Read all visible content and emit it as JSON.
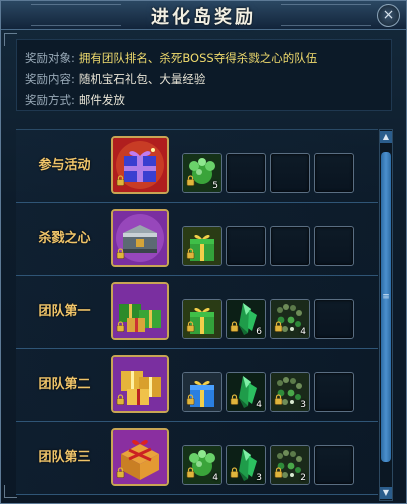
{
  "window": {
    "title": "进化岛奖励",
    "close_label": "×"
  },
  "info": [
    {
      "key": "奖励对象:",
      "value": "拥有团队排名、杀死BOSS夺得杀戮之心的队伍",
      "highlight": true
    },
    {
      "key": "奖励内容:",
      "value": "随机宝石礼包、大量经验",
      "highlight": false
    },
    {
      "key": "奖励方式:",
      "value": "邮件发放",
      "highlight": false
    }
  ],
  "rows": [
    {
      "label": "参与活动",
      "chest": "blue-gift-chest",
      "slots": [
        {
          "icon": "green-exp-orb-icon",
          "count": "5"
        },
        {
          "icon": "",
          "count": ""
        },
        {
          "icon": "",
          "count": ""
        },
        {
          "icon": "",
          "count": ""
        }
      ]
    },
    {
      "label": "杀戮之心",
      "chest": "ornate-treasure-chest",
      "slots": [
        {
          "icon": "green-gift-box-icon",
          "count": ""
        },
        {
          "icon": "",
          "count": ""
        },
        {
          "icon": "",
          "count": ""
        },
        {
          "icon": "",
          "count": ""
        }
      ]
    },
    {
      "label": "团队第一",
      "chest": "green-gift-pile",
      "slots": [
        {
          "icon": "green-gift-box-icon",
          "count": ""
        },
        {
          "icon": "green-crystal-icon",
          "count": "6"
        },
        {
          "icon": "bead-chain-icon",
          "count": "4"
        },
        {
          "icon": "",
          "count": ""
        }
      ]
    },
    {
      "label": "团队第二",
      "chest": "gold-gift-pile",
      "slots": [
        {
          "icon": "blue-gift-box-icon",
          "count": ""
        },
        {
          "icon": "green-crystal-icon",
          "count": "4"
        },
        {
          "icon": "bead-chain-icon",
          "count": "3"
        },
        {
          "icon": "",
          "count": ""
        }
      ]
    },
    {
      "label": "团队第三",
      "chest": "orange-gift-box",
      "slots": [
        {
          "icon": "green-exp-orb-icon",
          "count": "4"
        },
        {
          "icon": "green-crystal-icon",
          "count": "3"
        },
        {
          "icon": "bead-chain-icon",
          "count": "2"
        },
        {
          "icon": "",
          "count": ""
        }
      ]
    }
  ],
  "scrollbar": {
    "up": "▲",
    "down": "▼",
    "grip": "≡"
  }
}
